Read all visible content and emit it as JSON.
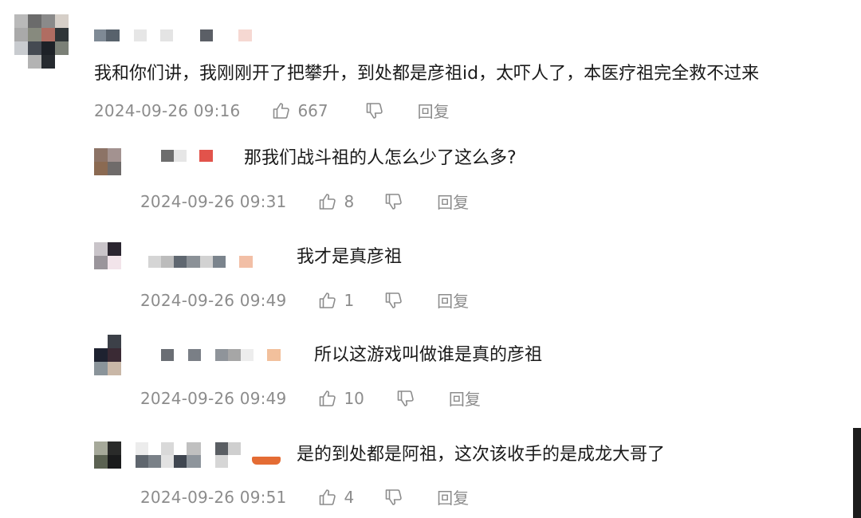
{
  "comments": [
    {
      "text": "我和你们讲，我刚刚开了把攀升，到处都是彦祖id，太吓人了，本医疗祖完全救不过来",
      "time": "2024-09-26 09:16",
      "likes": "667",
      "reply_label": "回复"
    }
  ],
  "replies": [
    {
      "text": "那我们战斗祖的人怎么少了这么多?",
      "time": "2024-09-26 09:31",
      "likes": "8",
      "reply_label": "回复"
    },
    {
      "text": "我才是真彦祖",
      "time": "2024-09-26 09:49",
      "likes": "1",
      "reply_label": "回复"
    },
    {
      "text": "所以这游戏叫做谁是真的彦祖",
      "time": "2024-09-26 09:49",
      "likes": "10",
      "reply_label": "回复"
    },
    {
      "text": "是的到处都是阿祖，这次该收手的是成龙大哥了",
      "time": "2024-09-26 09:51",
      "likes": "4",
      "reply_label": "回复"
    }
  ],
  "icons": {
    "like": "thumbs-up-icon",
    "dislike": "thumbs-down-icon"
  },
  "colors": {
    "meta_text": "#8c8c8c",
    "body_text": "#1a1a1a"
  }
}
